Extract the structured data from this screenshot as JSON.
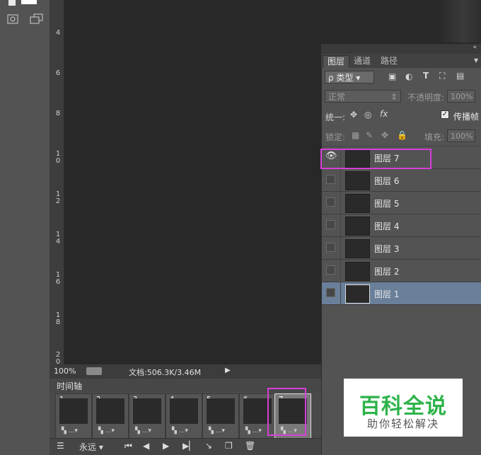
{
  "ruler": {
    "labels": [
      "4",
      "6",
      "8",
      "1\n0",
      "1\n2",
      "1\n4",
      "1\n6",
      "1\n8",
      "2\n0"
    ]
  },
  "status": {
    "zoom": "100%",
    "doc_info": "文档:506.3K/3.46M"
  },
  "timeline": {
    "title": "时间轴",
    "frames": [
      "1",
      "2",
      "3",
      "4",
      "5",
      "6",
      "7"
    ],
    "frame_delay": "...",
    "loop": "永远"
  },
  "panel": {
    "tabs": [
      "图层",
      "通道",
      "路径"
    ],
    "filter_label": "ρ 类型",
    "blend_mode": "正常",
    "opacity_label": "不透明度:",
    "opacity_value": "100%",
    "unify_label": "统一:",
    "propagate_label": "传播帧",
    "lock_label": "锁定:",
    "fill_label": "填充:",
    "fill_value": "100%",
    "layers": [
      "图层 7",
      "图层 6",
      "图层 5",
      "图层 4",
      "图层 3",
      "图层 2",
      "图层 1"
    ]
  },
  "watermark": {
    "title": "百科全说",
    "subtitle": "助你轻松解决"
  },
  "colors": {
    "highlight": "#d63fd6",
    "selected_layer": "#6a7f9a",
    "watermark_green": "#2db34a"
  }
}
